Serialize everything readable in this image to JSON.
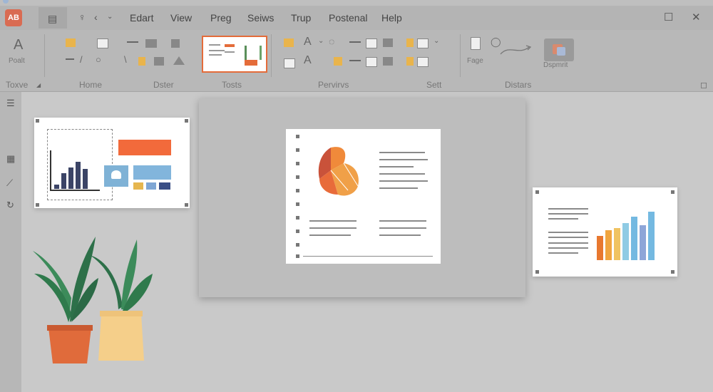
{
  "app": {
    "logo_text": "AB"
  },
  "menu": {
    "items": [
      "Edart",
      "View",
      "Preg",
      "Seiws",
      "Trup",
      "Postenal",
      "Help"
    ]
  },
  "ribbon": {
    "groups": [
      {
        "label": "Toxve"
      },
      {
        "label": "Home"
      },
      {
        "label": "Dster"
      },
      {
        "label": "Tosts"
      },
      {
        "label": "Pervirvs"
      },
      {
        "label": "Sett"
      },
      {
        "label": "Distars"
      }
    ],
    "buttons": {
      "font_label": "Poalt",
      "page_label": "Fage",
      "diagram_label": "Dspmrit"
    }
  },
  "colors": {
    "accent": "#e46c3a",
    "menu_bg": "#b4b4b4",
    "ribbon_bg": "#b8b8b8",
    "canvas_bg": "#c9c9c9"
  },
  "icons": {
    "app": "app-logo-icon",
    "save": "save-icon",
    "undo": "undo-icon",
    "redo": "redo-icon"
  }
}
